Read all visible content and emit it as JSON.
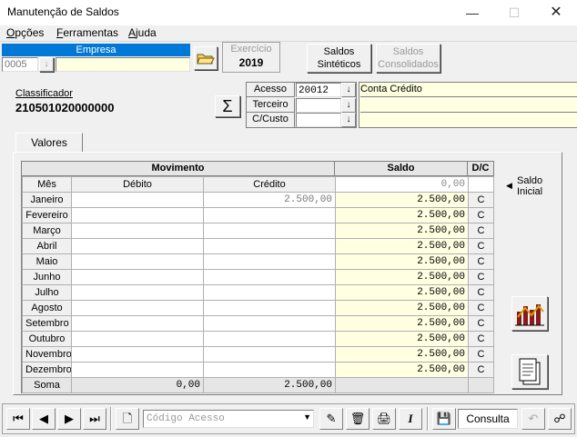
{
  "window": {
    "title": "Manutenção de Saldos"
  },
  "menu": [
    {
      "label": "Opções",
      "u": "O"
    },
    {
      "label": "Ferramentas",
      "u": "F"
    },
    {
      "label": "Ajuda",
      "u": "A"
    }
  ],
  "empresa": {
    "label": "Empresa",
    "code": "0005",
    "name": ""
  },
  "exercicio": {
    "label": "Exercício",
    "value": "2019"
  },
  "buttons": {
    "saldos_sinteticos": [
      "Saldos",
      "Sintéticos"
    ],
    "saldos_consolidados": [
      "Saldos",
      "Consolidados"
    ]
  },
  "classificador": {
    "label": "Classificador",
    "value": "210501020000000"
  },
  "acesso": {
    "label": "Acesso",
    "code": "20012",
    "desc": "Conta Crédito"
  },
  "terceiro": {
    "label": "Terceiro",
    "code": "",
    "desc": ""
  },
  "ccusto": {
    "label": "C/Custo",
    "code": "",
    "desc": ""
  },
  "tab": {
    "label": "Valores"
  },
  "grid": {
    "group_movimento": "Movimento",
    "group_saldo": "Saldo",
    "group_dc": "D/C",
    "col_mes": "Mês",
    "col_debito": "Débito",
    "col_credito": "Crédito",
    "saldo_inicial_value": "0,00",
    "saldo_inicial_label": [
      "Saldo",
      "Inicial"
    ],
    "rows": [
      {
        "mes": "Janeiro",
        "debito": "",
        "credito": "2.500,00",
        "saldo": "2.500,00",
        "dc": "C"
      },
      {
        "mes": "Fevereiro",
        "debito": "",
        "credito": "",
        "saldo": "2.500,00",
        "dc": "C"
      },
      {
        "mes": "Março",
        "debito": "",
        "credito": "",
        "saldo": "2.500,00",
        "dc": "C"
      },
      {
        "mes": "Abril",
        "debito": "",
        "credito": "",
        "saldo": "2.500,00",
        "dc": "C"
      },
      {
        "mes": "Maio",
        "debito": "",
        "credito": "",
        "saldo": "2.500,00",
        "dc": "C"
      },
      {
        "mes": "Junho",
        "debito": "",
        "credito": "",
        "saldo": "2.500,00",
        "dc": "C"
      },
      {
        "mes": "Julho",
        "debito": "",
        "credito": "",
        "saldo": "2.500,00",
        "dc": "C"
      },
      {
        "mes": "Agosto",
        "debito": "",
        "credito": "",
        "saldo": "2.500,00",
        "dc": "C"
      },
      {
        "mes": "Setembro",
        "debito": "",
        "credito": "",
        "saldo": "2.500,00",
        "dc": "C"
      },
      {
        "mes": "Outubro",
        "debito": "",
        "credito": "",
        "saldo": "2.500,00",
        "dc": "C"
      },
      {
        "mes": "Novembro",
        "debito": "",
        "credito": "",
        "saldo": "2.500,00",
        "dc": "C"
      },
      {
        "mes": "Dezembro",
        "debito": "",
        "credito": "",
        "saldo": "2.500,00",
        "dc": "C"
      }
    ],
    "soma": {
      "label": "Soma",
      "debito": "0,00",
      "credito": "2.500,00"
    }
  },
  "toolbar": {
    "codigo_acesso_placeholder": "Código Acesso",
    "mode_label": "Consulta"
  }
}
